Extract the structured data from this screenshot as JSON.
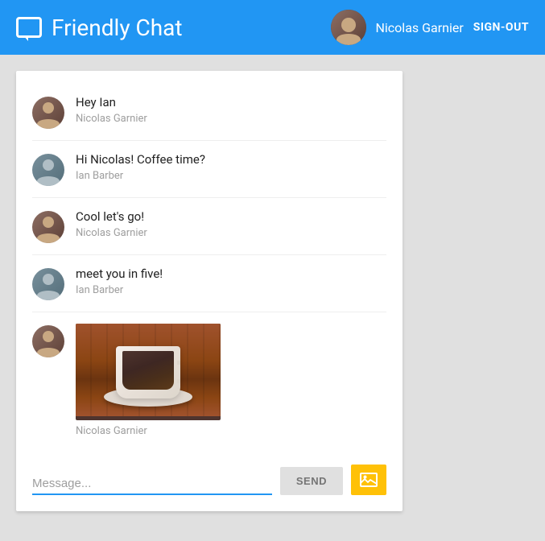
{
  "header": {
    "title": "Friendly Chat",
    "logo_icon_label": "chat-bubble-icon",
    "username": "Nicolas Garnier",
    "signout_label": "SIGN-OUT"
  },
  "chat": {
    "messages": [
      {
        "id": "msg-1",
        "text": "Hey Ian",
        "sender": "Nicolas Garnier",
        "avatar_type": "nicolas"
      },
      {
        "id": "msg-2",
        "text": "Hi Nicolas! Coffee time?",
        "sender": "Ian Barber",
        "avatar_type": "ian"
      },
      {
        "id": "msg-3",
        "text": "Cool let's go!",
        "sender": "Nicolas Garnier",
        "avatar_type": "nicolas"
      },
      {
        "id": "msg-4",
        "text": "meet you in five!",
        "sender": "Ian Barber",
        "avatar_type": "ian"
      },
      {
        "id": "msg-5",
        "text": "",
        "has_image": true,
        "sender": "Nicolas Garnier",
        "avatar_type": "nicolas"
      }
    ],
    "input": {
      "placeholder": "Message...",
      "label": "Message...",
      "value": ""
    },
    "send_button_label": "SEND",
    "image_button_label": "image-upload-button"
  }
}
